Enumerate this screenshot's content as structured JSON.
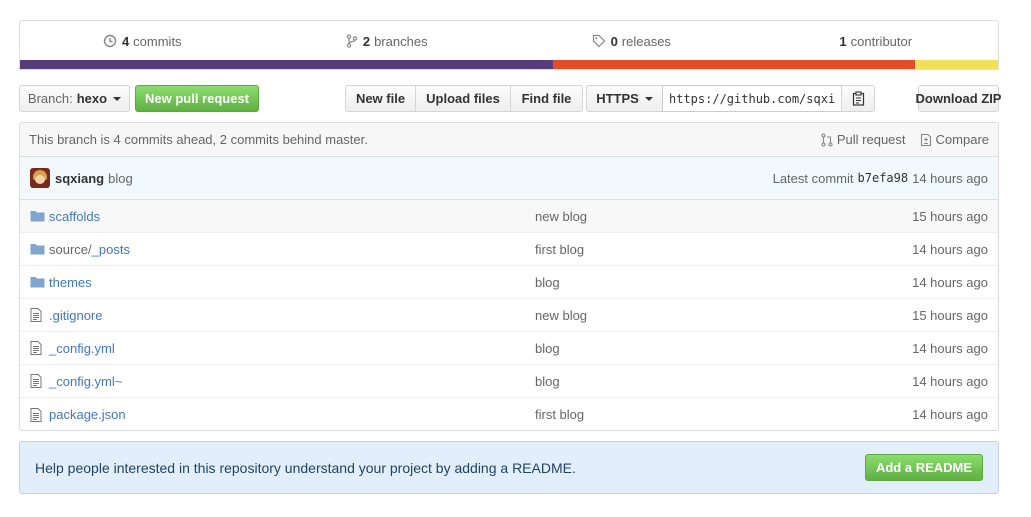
{
  "summary": {
    "commits_count": "4",
    "commits_label": "commits",
    "branches_count": "2",
    "branches_label": "branches",
    "releases_count": "0",
    "releases_label": "releases",
    "contributors_count": "1",
    "contributors_label": "contributor",
    "language_colors": [
      "#563d7c",
      "#e34c26",
      "#f1e05a"
    ],
    "language_share": [
      0.545,
      0.37,
      0.085
    ]
  },
  "toolbar": {
    "branch_prefix": "Branch:",
    "branch_name": "hexo",
    "new_pr_label": "New pull request",
    "new_file_label": "New file",
    "upload_files_label": "Upload files",
    "find_file_label": "Find file",
    "clone_protocol": "HTTPS",
    "clone_url": "https://github.com/sqxiang/sqxiang.github.io.git",
    "download_zip_label": "Download ZIP",
    "clipboard_icon": "clipboard-icon"
  },
  "branch_status": {
    "text": "This branch is 4 commits ahead, 2 commits behind master.",
    "pull_request_label": "Pull request",
    "compare_label": "Compare"
  },
  "latest_commit": {
    "author": "sqxiang",
    "message": "blog",
    "label": "Latest commit",
    "sha": "b7efa98",
    "age": "14 hours ago"
  },
  "files": [
    {
      "name": "scaffolds",
      "type": "dir",
      "message": "new blog",
      "age": "15 hours ago"
    },
    {
      "name": "source/_posts",
      "prefix": "source/",
      "rest": "_posts",
      "type": "dir",
      "message": "first blog",
      "age": "14 hours ago"
    },
    {
      "name": "themes",
      "type": "dir",
      "message": "blog",
      "age": "14 hours ago"
    },
    {
      "name": ".gitignore",
      "type": "file",
      "message": "new blog",
      "age": "15 hours ago"
    },
    {
      "name": "_config.yml",
      "type": "file",
      "message": "blog",
      "age": "14 hours ago"
    },
    {
      "name": "_config.yml~",
      "type": "file",
      "message": "blog",
      "age": "14 hours ago"
    },
    {
      "name": "package.json",
      "type": "file",
      "message": "first blog",
      "age": "14 hours ago"
    }
  ],
  "readme_banner": {
    "text": "Help people interested in this repository understand your project by adding a README.",
    "button_label": "Add a README"
  }
}
